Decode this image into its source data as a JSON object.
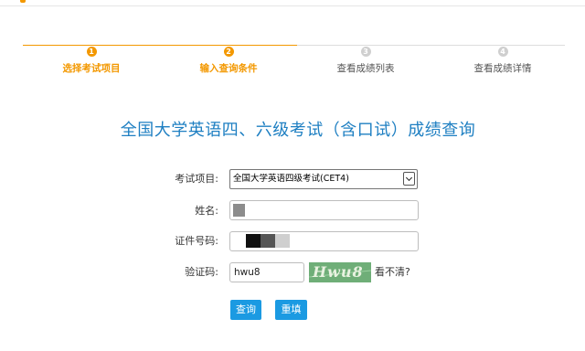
{
  "steps": [
    {
      "num": "1",
      "label": "选择考试项目",
      "state": "done"
    },
    {
      "num": "2",
      "label": "输入查询条件",
      "state": "current"
    },
    {
      "num": "3",
      "label": "查看成绩列表",
      "state": "pending"
    },
    {
      "num": "4",
      "label": "查看成绩详情",
      "state": "pending"
    }
  ],
  "title": "全国大学英语四、六级考试（含口试）成绩查询",
  "form": {
    "exam_label": "考试项目:",
    "exam_value": "全国大学英语四级考试(CET4)",
    "name_label": "姓名:",
    "id_label": "证件号码:",
    "captcha_label": "验证码:",
    "captcha_value": "hwu8",
    "captcha_image_text": "Hwu8",
    "refresh_text": "看不清?"
  },
  "buttons": {
    "query": "查询",
    "reset": "重填"
  },
  "colors": {
    "accent": "#f39800",
    "title": "#1e7fc2",
    "button": "#1b9ae2",
    "captcha_bg": "#6fae78"
  }
}
